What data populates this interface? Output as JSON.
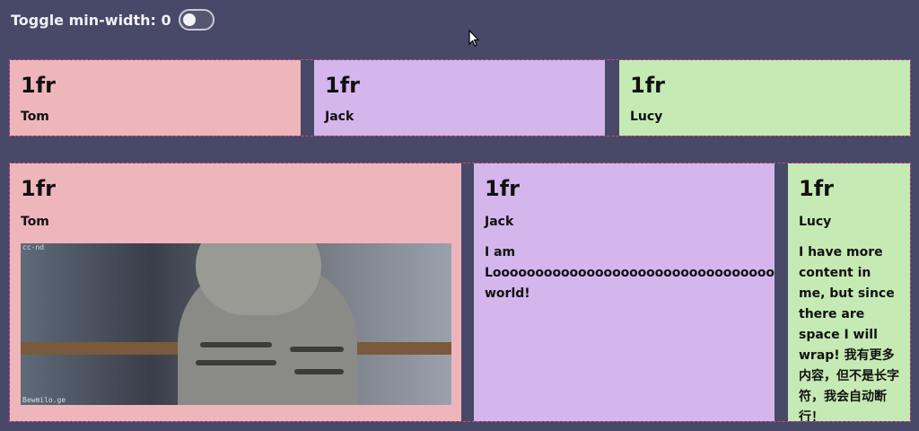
{
  "toggle": {
    "label": "Toggle min-width: 0",
    "on": false
  },
  "grid1": {
    "cells": [
      {
        "fr": "1fr",
        "name": "Tom"
      },
      {
        "fr": "1fr",
        "name": "Jack"
      },
      {
        "fr": "1fr",
        "name": "Lucy"
      }
    ]
  },
  "grid2": {
    "cells": [
      {
        "fr": "1fr",
        "name": "Tom",
        "image_overlay": "cc-nd",
        "image_credit": "Bewmilo.ge"
      },
      {
        "fr": "1fr",
        "name": "Jack",
        "text_line1": "I am",
        "text_long": "Looooooooooooooooooooooooooooooooooooong",
        "text_line3": "world!"
      },
      {
        "fr": "1fr",
        "name": "Lucy",
        "text": "I have more content in me, but since there are space I will wrap! 我有更多内容，但不是长字符，我会自动断行！"
      }
    ]
  },
  "colors": {
    "background": "#484869",
    "pink": "#eeb6bb",
    "purple": "#d4b6ed",
    "green": "#c6eab4"
  },
  "icons": {
    "cursor": "mouse-pointer-icon",
    "image": "cat-photo"
  }
}
